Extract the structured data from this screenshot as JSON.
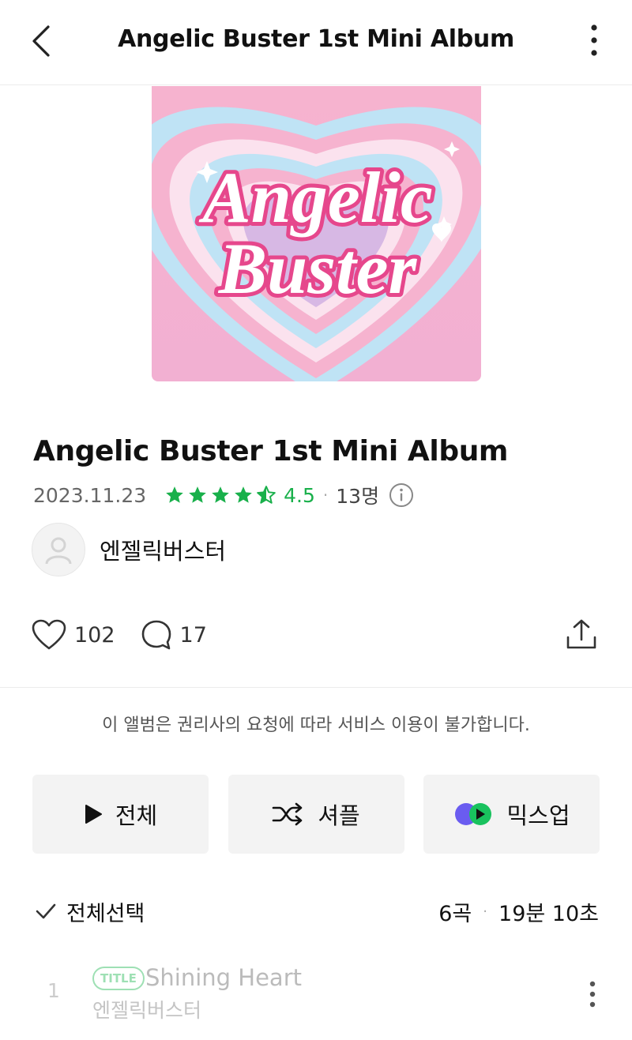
{
  "header": {
    "title": "Angelic Buster 1st Mini Album",
    "back_icon": "chevron-left-icon",
    "more_icon": "more-vertical-icon"
  },
  "album": {
    "cover_text_line1": "Angelic",
    "cover_text_line2": "Buster",
    "title": "Angelic Buster 1st Mini Album",
    "release_date": "2023.11.23",
    "rating": "4.5",
    "rating_value": 4.5,
    "rating_max": 5,
    "rating_count": "13명",
    "artist": "엔젤릭버스터"
  },
  "social": {
    "likes": "102",
    "comments": "17"
  },
  "notice": "이 앨범은 권리사의 요청에 따라 서비스 이용이 불가합니다.",
  "actions": {
    "play_all": "전체",
    "shuffle": "셔플",
    "mixup": "믹스업"
  },
  "tracklist": {
    "select_all": "전체선택",
    "track_count": "6곡",
    "total_duration": "19분 10초",
    "tracks": [
      {
        "number": "1",
        "badge": "TITLE",
        "title": "Shining Heart",
        "artist": "엔젤릭버스터"
      }
    ]
  },
  "colors": {
    "rating_green": "#19b04b",
    "badge_green": "#9ee0b4",
    "button_bg": "#f3f3f3",
    "cover_pink": "#f4a7c8",
    "cover_blue": "#bfe3f5"
  }
}
